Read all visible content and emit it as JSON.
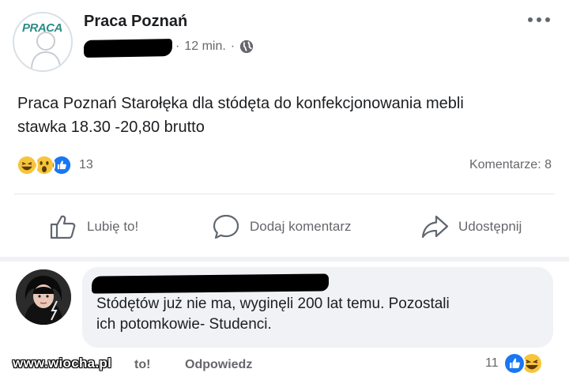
{
  "post": {
    "group_name": "Praca Poznań",
    "avatar_logo_text": "PRACA",
    "time": "12 min.",
    "dot": "·",
    "text_line1": "Praca Poznań Starołęka dla stódęta  do konfekcjonowania mebli",
    "text_line2": "stawka 18.30 -20,80 brutto",
    "reaction_count": "13",
    "comments_label": "Komentarze: 8",
    "icons": [
      "more-icon",
      "globe-icon",
      "haha-reaction-icon",
      "wow-reaction-icon",
      "like-reaction-icon"
    ]
  },
  "actions": {
    "like": "Lubię to!",
    "comment": "Dodaj komentarz",
    "share": "Udostępnij"
  },
  "comment": {
    "text_line1": "Stódętów już nie ma, wyginęli 200 lat temu. Pozostali",
    "text_line2": "ich potomkowie- Studenci.",
    "like_partial": "to!",
    "reply": "Odpowiedz",
    "reaction_count": "11"
  },
  "watermark": "www.wiocha.pl",
  "colors": {
    "text": "#1c1e21",
    "secondary": "#65676b",
    "like_blue": "#1877f2",
    "reaction_yellow": "#f7c53b",
    "comment_bubble": "#f0f2f5"
  }
}
